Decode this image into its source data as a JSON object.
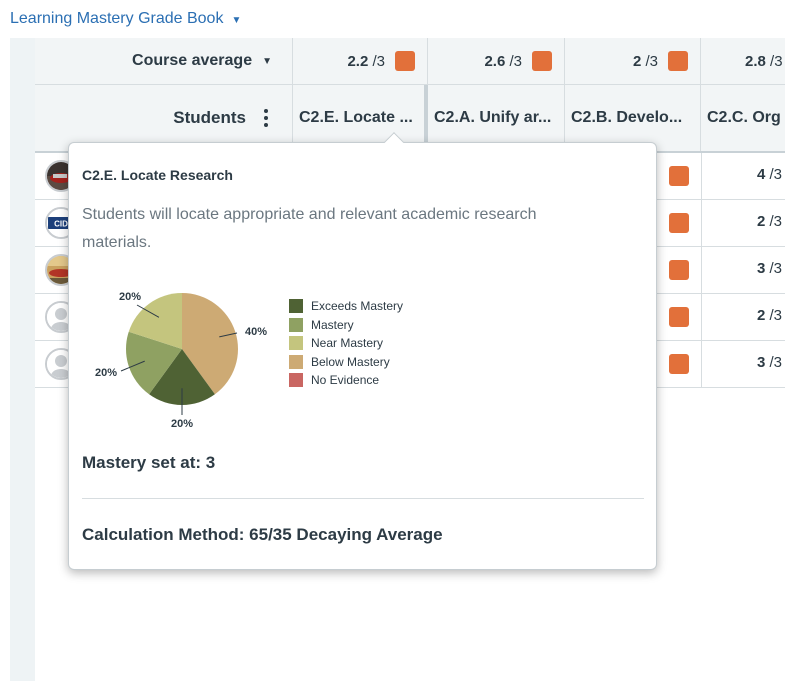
{
  "page": {
    "title": "Learning Mastery Grade Book"
  },
  "course_average": {
    "label": "Course average",
    "scores": [
      {
        "value": "2.2",
        "max": "/3"
      },
      {
        "value": "2.6",
        "max": "/3"
      },
      {
        "value": "2",
        "max": "/3"
      },
      {
        "value": "2.8",
        "max": "/3"
      }
    ]
  },
  "students_header": {
    "label": "Students",
    "outcomes": [
      "C2.E. Locate ...",
      "C2.A. Unify ar...",
      "C2.B. Develo...",
      "C2.C. Org"
    ]
  },
  "rows": [
    {
      "avatar": "photo",
      "score": "4",
      "max": "/3"
    },
    {
      "avatar": "logo",
      "score": "2",
      "max": "/3"
    },
    {
      "avatar": "photo",
      "score": "3",
      "max": "/3"
    },
    {
      "avatar": "default",
      "score": "2",
      "max": "/3"
    },
    {
      "avatar": "default",
      "score": "3",
      "max": "/3"
    }
  ],
  "popover": {
    "title": "C2.E. Locate Research",
    "description": "Students will locate appropriate and relevant academic research materials.",
    "mastery_set": "Mastery set at: 3",
    "calculation_method": "Calculation Method: 65/35 Decaying Average"
  },
  "chart_data": {
    "type": "pie",
    "slices": [
      {
        "label": "Below Mastery",
        "value": 40,
        "text": "40%",
        "color": "#cdaa74"
      },
      {
        "label": "Exceeds Mastery",
        "value": 20,
        "text": "20%",
        "color": "#4f6234"
      },
      {
        "label": "Mastery",
        "value": 20,
        "text": "20%",
        "color": "#8fa162"
      },
      {
        "label": "Near Mastery",
        "value": 20,
        "text": "20%",
        "color": "#c4c57e"
      }
    ],
    "legend": [
      {
        "label": "Exceeds Mastery",
        "color": "#4f6234"
      },
      {
        "label": "Mastery",
        "color": "#8fa162"
      },
      {
        "label": "Near Mastery",
        "color": "#c4c57e"
      },
      {
        "label": "Below Mastery",
        "color": "#cdaa74"
      },
      {
        "label": "No Evidence",
        "color": "#c96662"
      }
    ],
    "legend_placement": "right"
  },
  "colors": {
    "accent_link": "#2b6fb3",
    "score_swatch": "#e2703a"
  }
}
